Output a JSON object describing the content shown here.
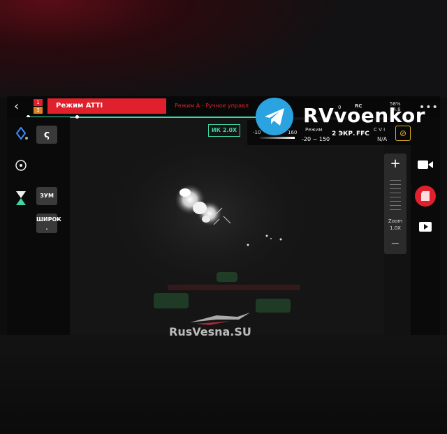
{
  "topbar": {
    "badge_top": "1",
    "badge_bottom": "3",
    "mode": "Режим ATTI",
    "mode_desc": "Режим A - Ручное управл"
  },
  "watermarks": {
    "telegram_channel": "RVvoenkor",
    "site": "RusVesna.SU"
  },
  "status": {
    "signal1": "0",
    "rc_label": "RC",
    "battery_pct": "58%",
    "battery_volt": "14.8",
    "range_left": "-10",
    "range_right": "160",
    "mode_label": "Режим",
    "range": "-20 ~ 150",
    "screens": "2 ЭКР.",
    "ffc": "FFC",
    "cvi": "C V I",
    "na": "N/A",
    "more": "•••",
    "ir_zoom": "ИК 2.0X"
  },
  "left_panel": {
    "zoom_btn": "ЗУМ",
    "wide_btn": "ШИРОК"
  },
  "zoom": {
    "plus": "+",
    "minus": "−",
    "label": "Zoom",
    "value": "1.0X"
  },
  "colors": {
    "accent_red": "#e0202c",
    "accent_green": "#3fd8a4",
    "telegram_blue": "#2aa3e0"
  }
}
